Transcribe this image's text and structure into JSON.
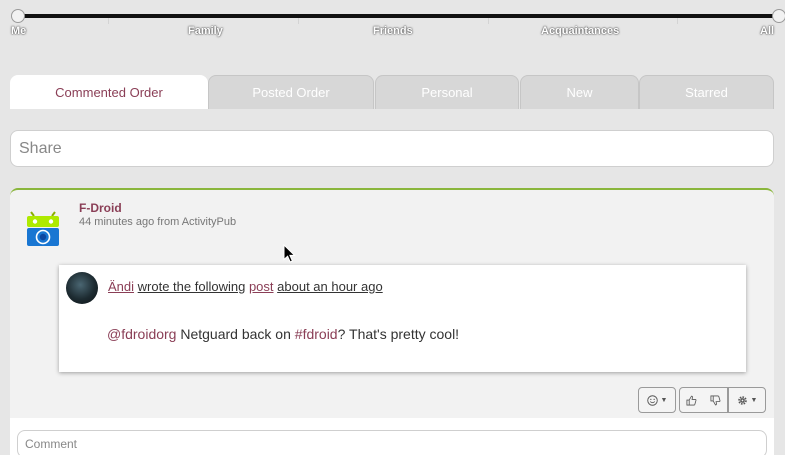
{
  "slider": {
    "labels": [
      "Me",
      "Family",
      "Friends",
      "Acquaintances",
      "All"
    ]
  },
  "tabs": [
    {
      "label": "Commented Order",
      "active": true
    },
    {
      "label": "Posted Order",
      "active": false
    },
    {
      "label": "Personal",
      "active": false
    },
    {
      "label": "New",
      "active": false
    },
    {
      "label": "Starred",
      "active": false
    }
  ],
  "share": {
    "placeholder": "Share"
  },
  "post": {
    "author": "F-Droid",
    "meta": "44 minutes ago from ActivityPub",
    "shared": {
      "author": "Ändi",
      "wrote": "wrote the following",
      "link": "post",
      "time": "about an hour ago",
      "mention": "@fdroidorg",
      "text_before_tag": "Netguard back on",
      "hashtag": "#fdroid",
      "text_after_tag": "? That's pretty cool!"
    }
  },
  "comment": {
    "placeholder": "Comment"
  },
  "colors": {
    "accent": "#8a3e56",
    "post_border": "#8ab63c",
    "background": "#e6e6e6"
  },
  "icons": {
    "emoji": "smiley-icon",
    "like": "thumbs-up-icon",
    "dislike": "thumbs-down-icon",
    "settings": "gear-icon"
  }
}
